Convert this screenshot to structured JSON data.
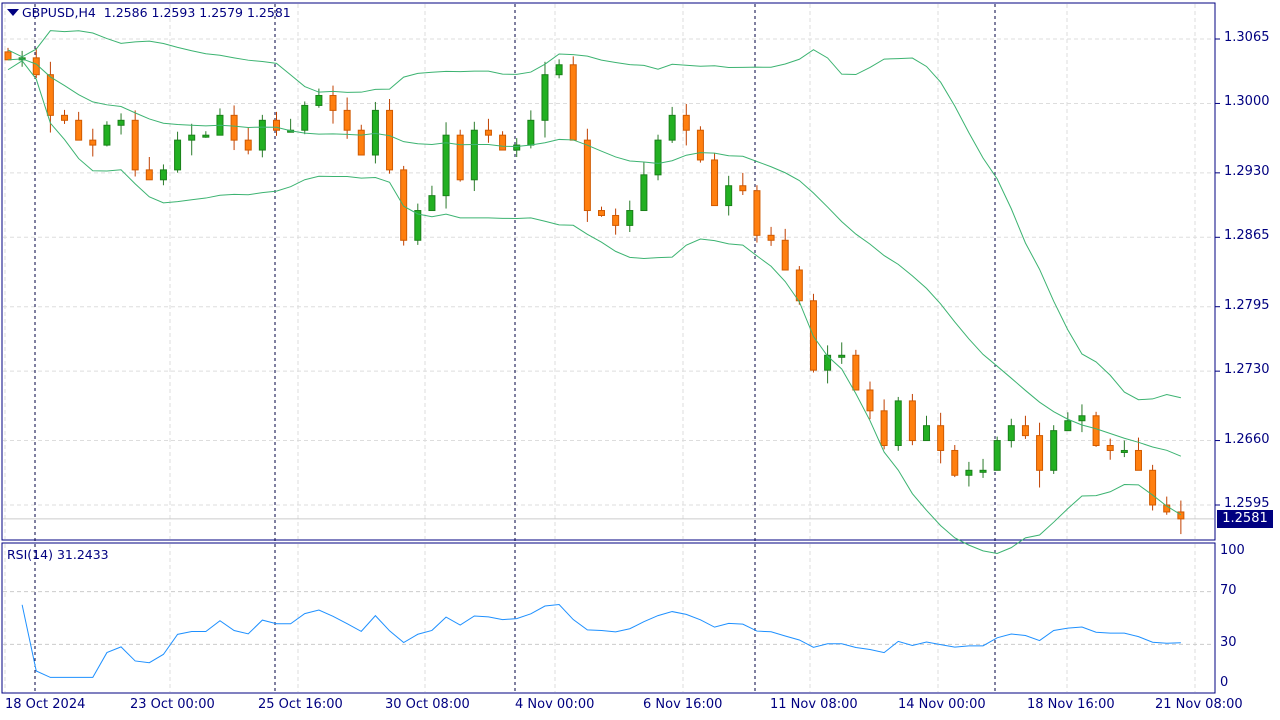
{
  "header": {
    "symbol": "GBPUSD,H4",
    "open": "1.2586",
    "high": "1.2593",
    "low": "1.2579",
    "close": "1.2581"
  },
  "current_price": "1.2581",
  "rsi": {
    "label": "RSI(14) 31.2433"
  },
  "chart_data": [
    {
      "type": "candlestick",
      "title": "GBPUSD,H4",
      "ylim": [
        1.2565,
        1.31
      ],
      "price_ticks": [
        "1.3065",
        "1.3000",
        "1.2930",
        "1.2865",
        "1.2795",
        "1.2730",
        "1.2660",
        "1.2595"
      ],
      "x_labels": [
        "18 Oct 2024",
        "23 Oct 00:00",
        "25 Oct 16:00",
        "30 Oct 08:00",
        "4 Nov 00:00",
        "6 Nov 16:00",
        "11 Nov 08:00",
        "14 Nov 00:00",
        "18 Nov 16:00",
        "21 Nov 08:00"
      ],
      "closes": [
        1.3044,
        1.3046,
        1.3029,
        1.2988,
        1.2983,
        1.2963,
        1.2958,
        1.2978,
        1.2983,
        1.2933,
        1.2923,
        1.2933,
        1.2963,
        1.2968,
        1.2968,
        1.2988,
        1.2963,
        1.2953,
        1.2983,
        1.2973,
        1.2973,
        1.2998,
        1.3008,
        1.2993,
        1.2973,
        1.2948,
        1.2993,
        1.2933,
        1.2862,
        1.2892,
        1.2907,
        1.2968,
        1.2923,
        1.2973,
        1.2968,
        1.2953,
        1.2958,
        1.2983,
        1.3029,
        1.3039,
        1.2963,
        1.2892,
        1.2887,
        1.2877,
        1.2892,
        1.2928,
        1.2963,
        1.2988,
        1.2973,
        1.2943,
        1.2897,
        1.2917,
        1.2912,
        1.2867,
        1.2862,
        1.2832,
        1.2801,
        1.2731,
        1.2746,
        1.2746,
        1.2711,
        1.269,
        1.2655,
        1.27,
        1.266,
        1.2675,
        1.265,
        1.2625,
        1.263,
        1.263,
        1.266,
        1.2675,
        1.2665,
        1.263,
        1.267,
        1.268,
        1.2685,
        1.2655,
        1.265,
        1.265,
        1.263,
        1.2595,
        1.2588,
        1.2581
      ],
      "indicators": [
        "Bollinger Bands(20,2)"
      ],
      "colors": {
        "up": "#22b022",
        "down": "#ff7f0f",
        "bands": "#3cb371",
        "axis": "#000080"
      }
    },
    {
      "type": "line",
      "title": "RSI(14)",
      "ylim": [
        0,
        100
      ],
      "y_ticks": [
        "100",
        "70",
        "30",
        "0"
      ],
      "value": 31.2433,
      "color": "#1e90ff"
    }
  ]
}
